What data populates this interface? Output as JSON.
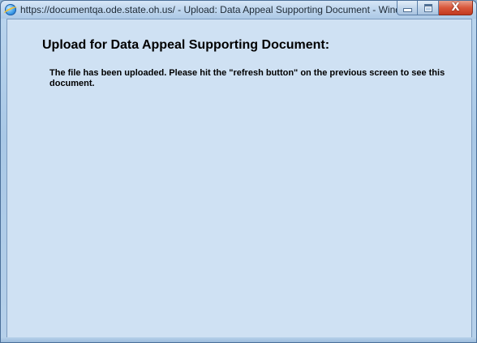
{
  "window": {
    "title": "https://documentqa.ode.state.oh.us/ - Upload: Data Appeal Supporting Document - Wind...",
    "controls": {
      "minimize_icon": "minimize-icon",
      "maximize_icon": "maximize-icon",
      "close_icon": "close-icon",
      "close_glyph": "X"
    },
    "title_icon": "internet-explorer-icon"
  },
  "page": {
    "heading": "Upload for Data Appeal Supporting Document:",
    "message": "The file has been uploaded. Please hit the \"refresh button\" on the previous screen to see this document."
  }
}
